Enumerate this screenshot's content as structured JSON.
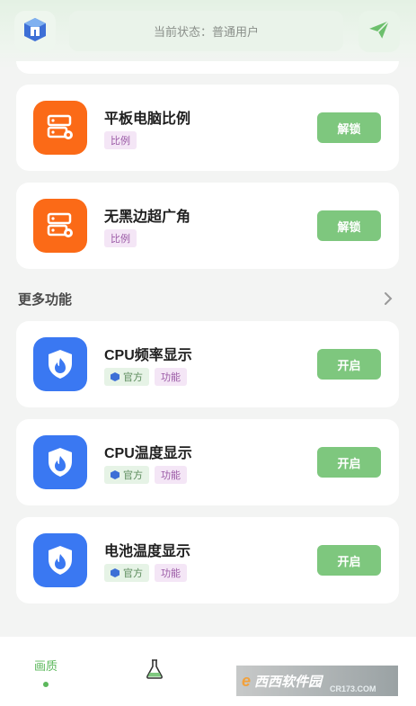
{
  "header": {
    "status_text": "当前状态：普通用户",
    "logo_icon": "app-logo-icon",
    "send_icon": "paper-plane-icon"
  },
  "ratio_cards": [
    {
      "title": "平板电脑比例",
      "tag": "比例",
      "button": "解锁",
      "icon": "server-settings-icon"
    },
    {
      "title": "无黑边超广角",
      "tag": "比例",
      "button": "解锁",
      "icon": "server-settings-icon"
    }
  ],
  "more_section": {
    "title": "更多功能",
    "icon": "chevron-right-icon"
  },
  "feature_cards": [
    {
      "title": "CPU频率显示",
      "tag_official": "官方",
      "tag_feature": "功能",
      "button": "开启",
      "icon": "shield-flame-icon"
    },
    {
      "title": "CPU温度显示",
      "tag_official": "官方",
      "tag_feature": "功能",
      "button": "开启",
      "icon": "shield-flame-icon"
    },
    {
      "title": "电池温度显示",
      "tag_official": "官方",
      "tag_feature": "功能",
      "button": "开启",
      "icon": "shield-flame-icon"
    }
  ],
  "bottom_nav": {
    "quality_label": "画质",
    "lab_icon": "flask-icon"
  },
  "watermark": {
    "brand": "西西软件园",
    "url": "CR173.COM"
  },
  "colors": {
    "accent_green": "#7ec77e",
    "orange": "#fb6a17",
    "blue": "#3a78f2"
  }
}
